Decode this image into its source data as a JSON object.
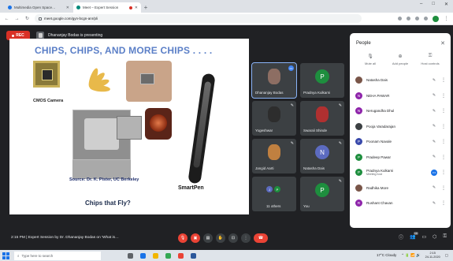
{
  "browser": {
    "tabs": [
      {
        "title": "Multimedia Open Space…",
        "active": false,
        "favicon_color": "#1a73e8"
      },
      {
        "title": "Meet – Expert Session",
        "active": true,
        "favicon_color": "#00897b",
        "recording": true
      }
    ],
    "url": "meet.google.com/gyn-bcgn-anr/pli",
    "window_controls": [
      "–",
      "□",
      "✕"
    ]
  },
  "meet": {
    "rec_label": "REC",
    "presenting_text": "Dhananjay Bodas is presenting",
    "slide": {
      "title": "CHIPS, CHIPS, AND MORE CHIPS . . . .",
      "label_cmos": "CMOS Camera",
      "label_source": "Source: Dr. K. Pister, UC Berkeley",
      "label_smartpen": "SmartPen",
      "label_fly": "Chips that Fly?"
    },
    "tiles": [
      {
        "name": "Dhananjay Bodas",
        "type": "photo",
        "color": "#8d6e63",
        "active": true
      },
      {
        "name": "Pradnya Kulkarni",
        "type": "letter",
        "letter": "P",
        "color": "#1e8e3e"
      },
      {
        "name": "Yogeshwar",
        "type": "photo",
        "color": "#2d2d2d"
      },
      {
        "name": "Swarali Shinde",
        "type": "photo",
        "color": "#b03030"
      },
      {
        "name": "Jangid Aarti",
        "type": "photo",
        "color": "#c08040"
      },
      {
        "name": "Natasha Dais",
        "type": "letter",
        "letter": "N",
        "color": "#5c6bc0"
      },
      {
        "name": "11 others",
        "type": "group"
      },
      {
        "name": "You",
        "type": "letter",
        "letter": "P",
        "color": "#1e8e3e"
      }
    ]
  },
  "people_panel": {
    "title": "People",
    "actions": [
      {
        "label": "Mute all",
        "icon": "mute-all-icon",
        "glyph": "🎙"
      },
      {
        "label": "Add people",
        "icon": "add-people-icon",
        "glyph": "👤"
      },
      {
        "label": "Host controls",
        "icon": "host-controls-icon",
        "glyph": "🔒"
      }
    ],
    "participants": [
      {
        "name": "Natasha Dais",
        "sub": "",
        "color": "#795548",
        "letter": "",
        "mic_blue": false
      },
      {
        "name": "NEHA PAWAR",
        "sub": "",
        "color": "#8e24aa",
        "letter": "N",
        "mic_blue": false
      },
      {
        "name": "Nerugandha Dhul",
        "sub": "",
        "color": "#8e24aa",
        "letter": "N",
        "mic_blue": false
      },
      {
        "name": "Pooja Varadarajan",
        "sub": "",
        "color": "#3c4043",
        "letter": "",
        "mic_blue": false
      },
      {
        "name": "Poonam Navale",
        "sub": "",
        "color": "#3949ab",
        "letter": "P",
        "mic_blue": false
      },
      {
        "name": "Pradeep Pawar",
        "sub": "",
        "color": "#1e8e3e",
        "letter": "P",
        "mic_blue": false
      },
      {
        "name": "Pradnya Kulkarni",
        "sub": "Meeting host",
        "color": "#1e8e3e",
        "letter": "P",
        "mic_blue": true
      },
      {
        "name": "Radhika More",
        "sub": "",
        "color": "#795548",
        "letter": "",
        "mic_blue": false
      },
      {
        "name": "Rushant Chavan",
        "sub": "",
        "color": "#8e24aa",
        "letter": "R",
        "mic_blue": false
      }
    ]
  },
  "bottom": {
    "meeting_info": "2:15 PM  |  Expert Session by Dr. Dhananjay Bodas on 'What is…",
    "participants_count": "19"
  },
  "taskbar": {
    "search_placeholder": "Type here to search",
    "weather": "17°C Cloudy",
    "time": "2:15",
    "date": "24-11-2020"
  }
}
